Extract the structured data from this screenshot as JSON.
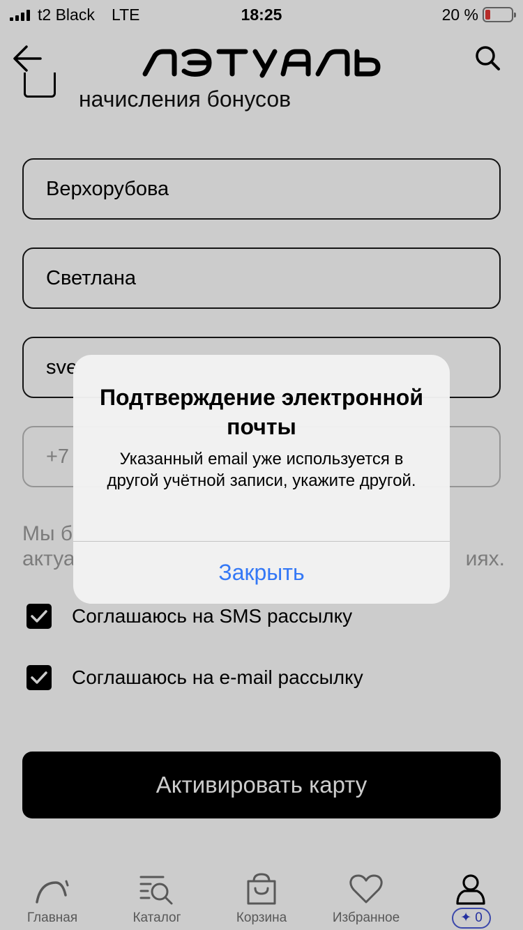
{
  "status_bar": {
    "carrier": "t2 Black",
    "network": "LTE",
    "time": "18:25",
    "battery_percent": "20 %",
    "battery_level": 0.2,
    "battery_color": "#e53935"
  },
  "header": {
    "logo_text": "ЛЭТУАЛЬ",
    "back_icon": "arrow-left-icon",
    "search_icon": "search-icon"
  },
  "form": {
    "bonus_checkbox_label": "начисления бонусов",
    "last_name": "Верхорубова",
    "first_name": "Светлана",
    "email": "sve",
    "phone": "+7",
    "info_text_line1": "Мы б",
    "info_text_line2_start": "актуа",
    "info_text_line2_end": "иях.",
    "sms_consent": {
      "label": "Соглашаюсь на SMS рассылку",
      "checked": true
    },
    "email_consent": {
      "label": "Соглашаюсь на e-mail рассылку",
      "checked": true
    },
    "activate_button": "Активировать карту"
  },
  "tab_bar": {
    "items": [
      {
        "label": "Главная",
        "icon": "home-arc-icon"
      },
      {
        "label": "Каталог",
        "icon": "catalog-search-icon"
      },
      {
        "label": "Корзина",
        "icon": "bag-icon"
      },
      {
        "label": "Избранное",
        "icon": "heart-icon"
      },
      {
        "label": "",
        "icon": "user-icon",
        "badge": "✦ 0"
      }
    ]
  },
  "alert": {
    "title": "Подтверждение электронной почты",
    "message": "Указанный email уже используется в другой учётной записи, укажите другой.",
    "close_button": "Закрыть",
    "accent_color": "#3478f6"
  }
}
